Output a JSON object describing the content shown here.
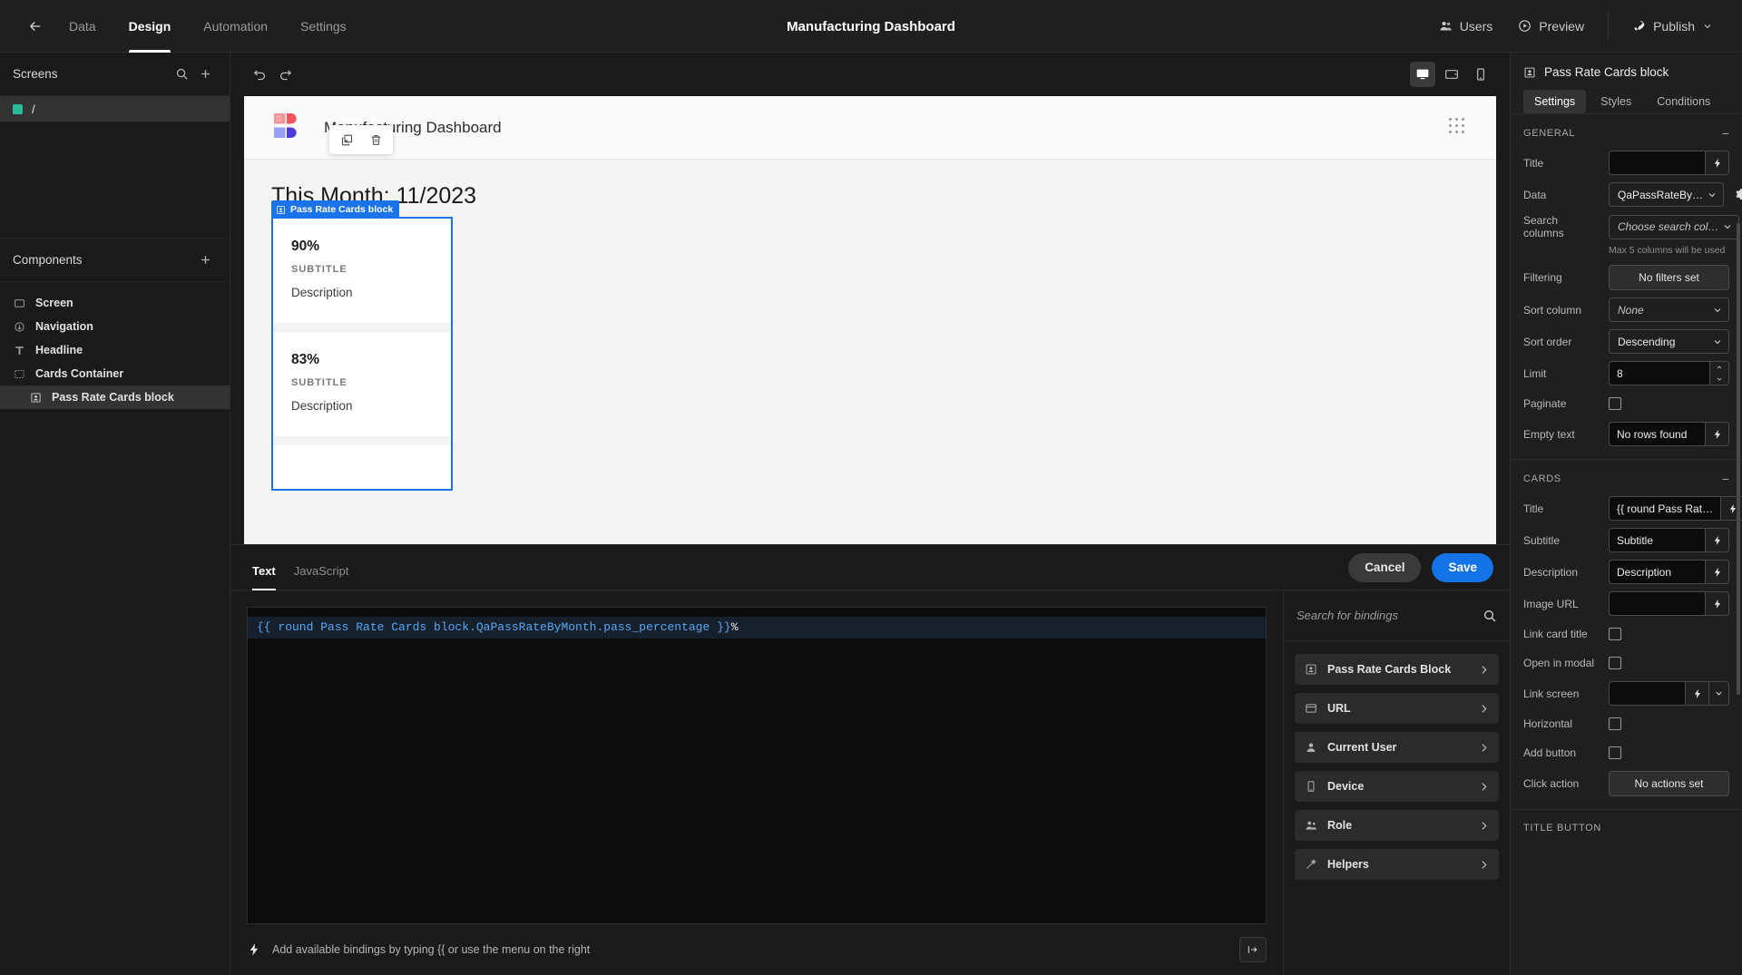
{
  "topbar": {
    "back_icon": "arrow-left-icon",
    "tabs": [
      {
        "label": "Data",
        "active": false
      },
      {
        "label": "Design",
        "active": true
      },
      {
        "label": "Automation",
        "active": false
      },
      {
        "label": "Settings",
        "active": false
      }
    ],
    "title": "Manufacturing Dashboard",
    "users_label": "Users",
    "preview_label": "Preview",
    "publish_label": "Publish"
  },
  "sidebar": {
    "screens_header": "Screens",
    "search_icon": "search-icon",
    "add_icon": "plus-icon",
    "screens": [
      {
        "label": "/",
        "selected": true
      }
    ],
    "components_header": "Components",
    "components_add_icon": "plus-icon",
    "components": [
      {
        "label": "Screen",
        "icon": "screen-icon",
        "indent": false,
        "selected": false
      },
      {
        "label": "Navigation",
        "icon": "navigation-icon",
        "indent": false,
        "selected": false
      },
      {
        "label": "Headline",
        "icon": "headline-icon",
        "indent": false,
        "selected": false
      },
      {
        "label": "Cards Container",
        "icon": "cards-container-icon",
        "indent": false,
        "selected": false
      },
      {
        "label": "Pass Rate Cards block",
        "icon": "card-block-icon",
        "indent": true,
        "selected": true
      }
    ]
  },
  "canvas_bar": {
    "undo_icon": "undo-icon",
    "redo_icon": "redo-icon",
    "devices": [
      {
        "name": "desktop-preview",
        "active": true
      },
      {
        "name": "tablet-preview",
        "active": false
      },
      {
        "name": "mobile-preview",
        "active": false
      }
    ]
  },
  "canvas": {
    "app_title": "Manufacturing Dashboard",
    "grip_icon": "drag-grip-icon",
    "headline": "This Month: 11/2023",
    "float_toolbar": [
      {
        "name": "duplicate-icon"
      },
      {
        "name": "delete-icon"
      }
    ],
    "selection_tag": "Pass Rate Cards block",
    "cards": [
      {
        "title": "90%",
        "subtitle": "SUBTITLE",
        "description": "Description"
      },
      {
        "title": "83%",
        "subtitle": "SUBTITLE",
        "description": "Description"
      }
    ]
  },
  "drawer": {
    "tabs": [
      {
        "label": "Text",
        "active": true
      },
      {
        "label": "JavaScript",
        "active": false
      }
    ],
    "cancel_label": "Cancel",
    "save_label": "Save",
    "code_binding": "{{ round Pass Rate Cards block.QaPassRateByMonth.pass_percentage }}",
    "code_suffix": "%",
    "footer_hint": "Add available bindings by typing {{ or use the menu on the right",
    "expand_icon": "expand-icon",
    "bindings": {
      "search_placeholder": "Search for bindings",
      "search_icon": "search-icon",
      "items": [
        {
          "label": "Pass Rate Cards Block",
          "icon": "card-block-icon"
        },
        {
          "label": "URL",
          "icon": "url-icon"
        },
        {
          "label": "Current User",
          "icon": "user-icon"
        },
        {
          "label": "Device",
          "icon": "device-icon"
        },
        {
          "label": "Role",
          "icon": "role-icon"
        },
        {
          "label": "Helpers",
          "icon": "helpers-icon"
        }
      ]
    }
  },
  "rightpanel": {
    "title": "Pass Rate Cards block",
    "title_icon": "card-block-icon",
    "tabs": [
      {
        "label": "Settings",
        "active": true
      },
      {
        "label": "Styles",
        "active": false
      },
      {
        "label": "Conditions",
        "active": false
      }
    ],
    "sections": [
      {
        "name": "GENERAL",
        "title": "GENERAL",
        "collapse_icon": "minus-icon",
        "rows": [
          {
            "label": "Title",
            "type": "bolt-field",
            "value": ""
          },
          {
            "label": "Data",
            "type": "select-gear",
            "value": "QaPassRateBy…"
          },
          {
            "label": "Search columns",
            "type": "select",
            "value": "Choose search col…",
            "placeholder": true
          },
          {
            "label": "",
            "type": "hint",
            "value": "Max 5 columns will be used"
          },
          {
            "label": "Filtering",
            "type": "button",
            "value": "No filters set"
          },
          {
            "label": "Sort column",
            "type": "select",
            "value": "None",
            "placeholder": true
          },
          {
            "label": "Sort order",
            "type": "select",
            "value": "Descending",
            "placeholder": false
          },
          {
            "label": "Limit",
            "type": "stepper",
            "value": "8"
          },
          {
            "label": "Paginate",
            "type": "checkbox",
            "checked": false
          },
          {
            "label": "Empty text",
            "type": "bolt-field",
            "value": "No rows found"
          }
        ]
      },
      {
        "name": "CARDS",
        "title": "CARDS",
        "collapse_icon": "minus-icon",
        "rows": [
          {
            "label": "Title",
            "type": "bolt-field",
            "value": "{{ round Pass Rat…"
          },
          {
            "label": "Subtitle",
            "type": "bolt-field",
            "value": "Subtitle"
          },
          {
            "label": "Description",
            "type": "bolt-field",
            "value": "Description"
          },
          {
            "label": "Image URL",
            "type": "bolt-field",
            "value": ""
          },
          {
            "label": "Link card title",
            "type": "checkbox",
            "checked": false
          },
          {
            "label": "Open in modal",
            "type": "checkbox",
            "checked": false
          },
          {
            "label": "Link screen",
            "type": "bolt-field-dd",
            "value": ""
          },
          {
            "label": "Horizontal",
            "type": "checkbox",
            "checked": false
          },
          {
            "label": "Add button",
            "type": "checkbox",
            "checked": false
          },
          {
            "label": "Click action",
            "type": "button",
            "value": "No actions set"
          }
        ]
      },
      {
        "name": "TITLE-BUTTON",
        "title": "TITLE BUTTON",
        "collapse_icon": "",
        "rows": []
      }
    ]
  }
}
